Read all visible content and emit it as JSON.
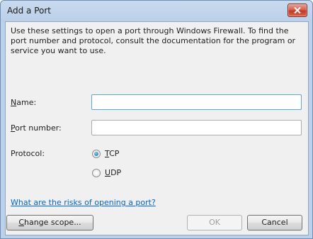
{
  "window": {
    "title": "Add a Port"
  },
  "description": "Use these settings to open a port through Windows Firewall. To find the port number and protocol, consult the documentation for the program or service you want to use.",
  "form": {
    "name": {
      "label_accel": "N",
      "label_rest": "ame:",
      "value": ""
    },
    "port_number": {
      "label_accel": "P",
      "label_rest": "ort number:",
      "value": ""
    },
    "protocol": {
      "label": "Protocol:",
      "selected": "TCP",
      "options": [
        {
          "accel": "T",
          "rest": "CP",
          "checked": true
        },
        {
          "accel": "U",
          "rest": "DP",
          "checked": false
        }
      ]
    }
  },
  "help_link": "What are the risks of opening a port?",
  "buttons": {
    "change_scope_accel": "C",
    "change_scope_rest": "hange scope...",
    "ok": "OK",
    "cancel": "Cancel"
  },
  "colors": {
    "link": "#0066cc",
    "close_button": "#c23a26",
    "dialog_face": "#f0f0f0",
    "title_bar": "#bcd0ea"
  }
}
